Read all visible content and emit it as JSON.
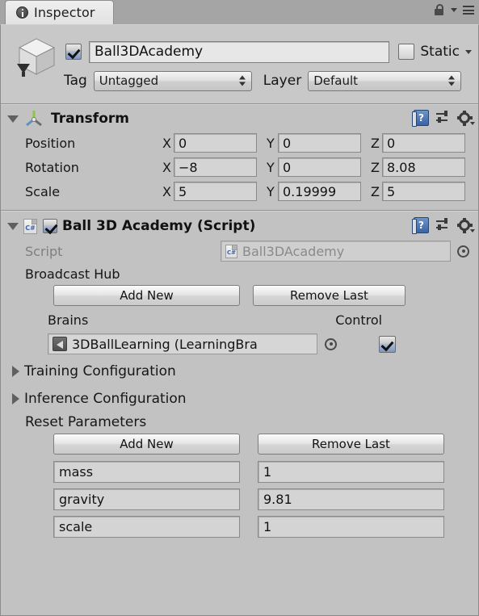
{
  "window": {
    "tab_label": "Inspector",
    "tab_icon": "info-icon",
    "lock_icon": "lock-icon",
    "menu_icon": "burger-menu-icon"
  },
  "object_header": {
    "preview_icon": "cube-icon",
    "enabled": true,
    "name": "Ball3DAcademy",
    "name_placeholder": "Name",
    "static_label": "Static",
    "static_checked": false,
    "tag_label": "Tag",
    "tag_value": "Untagged",
    "layer_label": "Layer",
    "layer_value": "Default"
  },
  "transform": {
    "icon": "transform-axis-icon",
    "title": "Transform",
    "expanded": true,
    "help_icon": "help-book-icon",
    "preset_icon": "preset-sliders-icon",
    "gear_icon": "gear-icon",
    "rows": [
      {
        "label": "Position",
        "x": "0",
        "y": "0",
        "z": "0"
      },
      {
        "label": "Rotation",
        "x": "−8",
        "y": "0",
        "z": "8.08"
      },
      {
        "label": "Scale",
        "x": "5",
        "y": "0.19999",
        "z": "5"
      }
    ],
    "axis_x": "X",
    "axis_y": "Y",
    "axis_z": "Z"
  },
  "script_component": {
    "icon": "csharp-script-icon",
    "enabled": true,
    "title": "Ball 3D Academy (Script)",
    "expanded": true,
    "help_icon": "help-book-icon",
    "preset_icon": "preset-sliders-icon",
    "gear_icon": "gear-icon",
    "script_label": "Script",
    "script_value": "Ball3DAcademy",
    "script_picker_icon": "object-picker-icon",
    "broadcast_hub": {
      "title": "Broadcast Hub",
      "add_new_label": "Add New",
      "remove_last_label": "Remove Last",
      "brains_label": "Brains",
      "control_label": "Control",
      "entries": [
        {
          "brain": "3DBallLearning (LearningBra",
          "brain_icon": "unity-asset-icon",
          "picker_icon": "object-picker-icon",
          "control": true
        }
      ]
    },
    "foldouts": [
      {
        "label": "Training Configuration",
        "expanded": false
      },
      {
        "label": "Inference Configuration",
        "expanded": false
      }
    ],
    "reset_parameters": {
      "title": "Reset Parameters",
      "add_new_label": "Add New",
      "remove_last_label": "Remove Last",
      "rows": [
        {
          "key": "mass",
          "value": "1"
        },
        {
          "key": "gravity",
          "value": "9.81"
        },
        {
          "key": "scale",
          "value": "1"
        }
      ]
    }
  },
  "colors": {
    "panel_bg": "#c2c2c2",
    "header_bg": "#c8c8c8",
    "window_bg": "#a5a5a5",
    "checkbox_blue": "#7e95c4",
    "help_blue": "#3a63a5",
    "disabled_text": "#8a8a8a"
  }
}
